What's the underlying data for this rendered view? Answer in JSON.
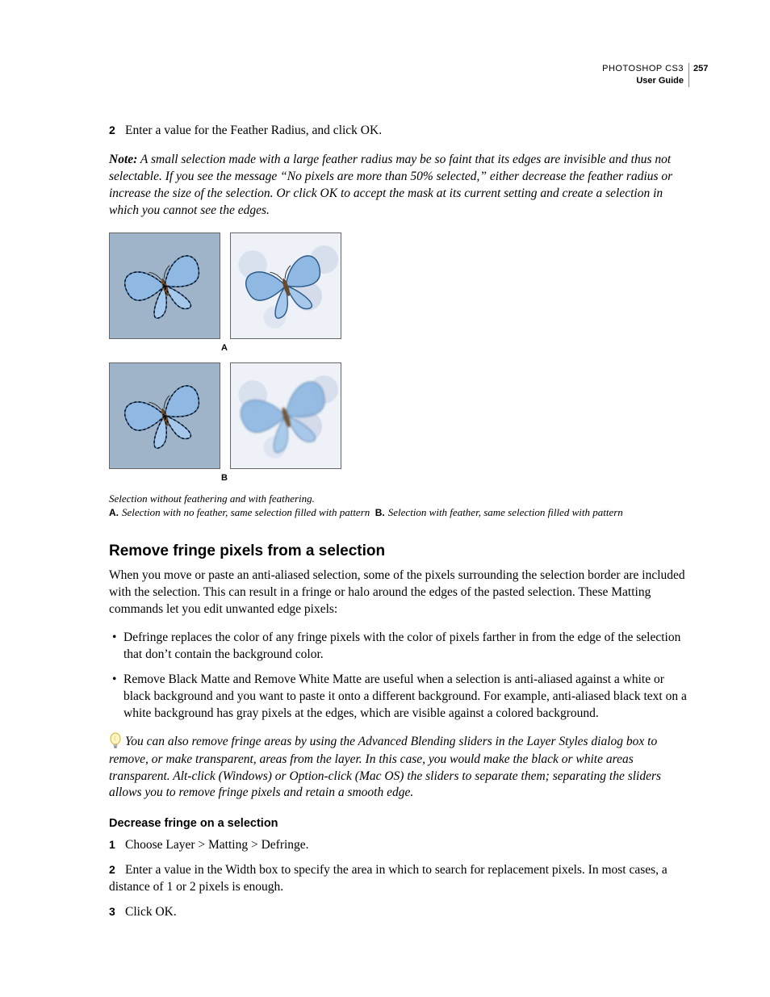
{
  "header": {
    "product": "PHOTOSHOP CS3",
    "guide": "User Guide",
    "page": "257"
  },
  "step2": {
    "num": "2",
    "text": "Enter a value for the Feather Radius, and click OK."
  },
  "note": {
    "label": "Note:",
    "text": "A small selection made with a large feather radius may be so faint that its edges are invisible and thus not selectable. If you see the message “No pixels are more than 50% selected,” either decrease the feather radius or increase the size of the selection. Or click OK to accept the mask at its current setting and create a selection in which you cannot see the edges."
  },
  "figure": {
    "labelA": "A",
    "labelB": "B",
    "caption_main": "Selection without feathering and with feathering.",
    "caption_keyA": "A.",
    "caption_textA": "Selection with no feather, same selection filled with pattern",
    "caption_keyB": "B.",
    "caption_textB": "Selection with feather, same selection filled with pattern"
  },
  "section": {
    "heading": "Remove fringe pixels from a selection",
    "intro": "When you move or paste an anti-aliased selection, some of the pixels surrounding the selection border are included with the selection. This can result in a fringe or halo around the edges of the pasted selection. These Matting commands let you edit unwanted edge pixels:",
    "bullets": [
      "Defringe replaces the color of any fringe pixels with the color of pixels farther in from the edge of the selection that don’t contain the background color.",
      "Remove Black Matte and Remove White Matte are useful when a selection is anti-aliased against a white or black background and you want to paste it onto a different background. For example, anti-aliased black text on a white background has gray pixels at the edges, which are visible against a colored background."
    ],
    "tip": "You can also remove fringe areas by using the Advanced Blending sliders in the Layer Styles dialog box to remove, or make transparent, areas from the layer. In this case, you would make the black or white areas transparent. Alt-click (Windows) or Option-click (Mac OS) the sliders to separate them; separating the sliders allows you to remove fringe pixels and retain a smooth edge."
  },
  "subsection": {
    "heading": "Decrease fringe on a selection",
    "steps": [
      {
        "num": "1",
        "text": "Choose Layer > Matting > Defringe."
      },
      {
        "num": "2",
        "text": "Enter a value in the Width box to specify the area in which to search for replacement pixels. In most cases, a distance of 1 or 2 pixels is enough."
      },
      {
        "num": "3",
        "text": "Click OK."
      }
    ]
  }
}
